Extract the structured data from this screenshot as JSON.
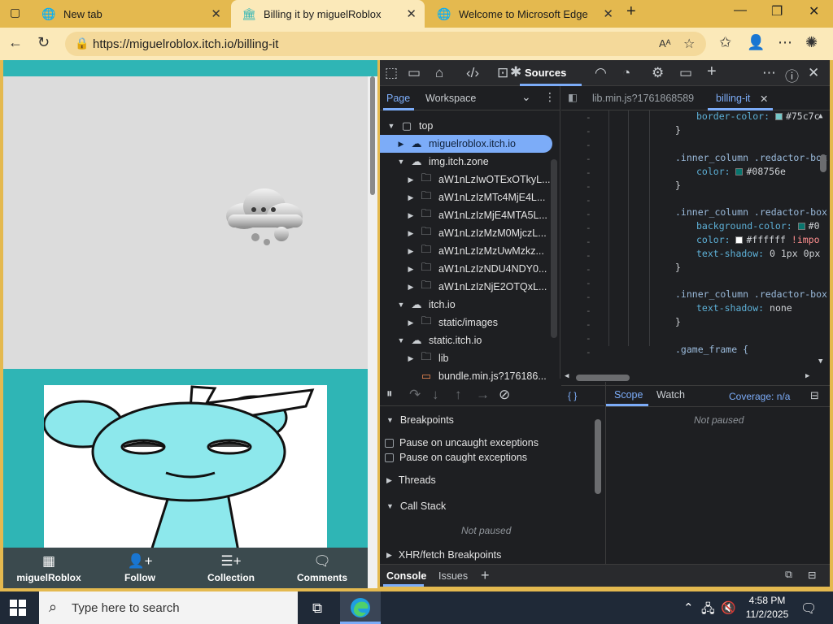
{
  "browser": {
    "tabs": [
      {
        "label": "New tab",
        "icon": "globe-icon"
      },
      {
        "label": "Billing it by miguelRoblox",
        "icon": "itch-icon"
      },
      {
        "label": "Welcome to Microsoft Edge",
        "icon": "globe-icon"
      }
    ],
    "url": "https://miguelroblox.itch.io/billing-it"
  },
  "page": {
    "bottom_nav": [
      {
        "label": "miguelRoblox",
        "icon": "store-icon"
      },
      {
        "label": "Follow",
        "icon": "add-user-icon"
      },
      {
        "label": "Collection",
        "icon": "add-list-icon"
      },
      {
        "label": "Comments",
        "icon": "comment-icon"
      }
    ]
  },
  "devtools": {
    "active_panel": "Sources",
    "nav_tabs": [
      "Page",
      "Workspace"
    ],
    "tree": [
      {
        "label": "top",
        "type": "frame",
        "indent": 0,
        "open": true
      },
      {
        "label": "miguelroblox.itch.io",
        "type": "cloud",
        "indent": 1,
        "open": false,
        "selected": true
      },
      {
        "label": "img.itch.zone",
        "type": "cloud",
        "indent": 1,
        "open": true
      },
      {
        "label": "aW1nLzIwOTExOTkyL...",
        "type": "folder",
        "indent": 2,
        "open": false
      },
      {
        "label": "aW1nLzIzMTc4MjE4L...",
        "type": "folder",
        "indent": 2,
        "open": false
      },
      {
        "label": "aW1nLzIzMjE4MTA5L...",
        "type": "folder",
        "indent": 2,
        "open": false
      },
      {
        "label": "aW1nLzIzMzM0MjczL...",
        "type": "folder",
        "indent": 2,
        "open": false
      },
      {
        "label": "aW1nLzIzMzUwMzkz...",
        "type": "folder",
        "indent": 2,
        "open": false
      },
      {
        "label": "aW1nLzIzNDU4NDY0...",
        "type": "folder",
        "indent": 2,
        "open": false
      },
      {
        "label": "aW1nLzIzNjE2OTQxL...",
        "type": "folder",
        "indent": 2,
        "open": false
      },
      {
        "label": "itch.io",
        "type": "cloud",
        "indent": 1,
        "open": true
      },
      {
        "label": "static/images",
        "type": "folder",
        "indent": 2,
        "open": false
      },
      {
        "label": "static.itch.io",
        "type": "cloud",
        "indent": 1,
        "open": true
      },
      {
        "label": "lib",
        "type": "folder",
        "indent": 2,
        "open": false
      },
      {
        "label": "bundle.min.js?176186...",
        "type": "file",
        "indent": 2,
        "open": null
      }
    ],
    "editor_tabs": [
      "lib.min.js?1761868589",
      "billing-it"
    ],
    "code": {
      "l0_prop": "border-color:",
      "l0_val": "#75c7c",
      "brace": "}",
      "sel1": ".inner_column .redactor-box",
      "prop_color": "color:",
      "val_1": "#08756e",
      "prop_bg": "background-color:",
      "val_bg": "#0",
      "val_white": "#ffffff",
      "important": "!impo",
      "prop_ts": "text-shadow:",
      "val_ts": "0 1px 0px",
      "val_none": "none",
      "sel_game": ".game_frame {"
    },
    "swatch_colors": {
      "teal_light": "#75c7c7",
      "teal_dark": "#08756e",
      "white": "#ffffff"
    },
    "footer": {
      "braces": "{ }",
      "coverage": "Coverage: n/a"
    },
    "debugger": {
      "breakpoints_label": "Breakpoints",
      "pause_uncaught": "Pause on uncaught exceptions",
      "pause_caught": "Pause on caught exceptions",
      "threads_label": "Threads",
      "call_stack_label": "Call Stack",
      "not_paused": "Not paused",
      "xhr_label": "XHR/fetch Breakpoints"
    },
    "scope_tabs": [
      "Scope",
      "Watch"
    ],
    "drawer_tabs": [
      "Console",
      "Issues"
    ]
  },
  "taskbar": {
    "search_placeholder": "Type here to search",
    "time": "4:58 PM",
    "date": "11/2/2025"
  }
}
